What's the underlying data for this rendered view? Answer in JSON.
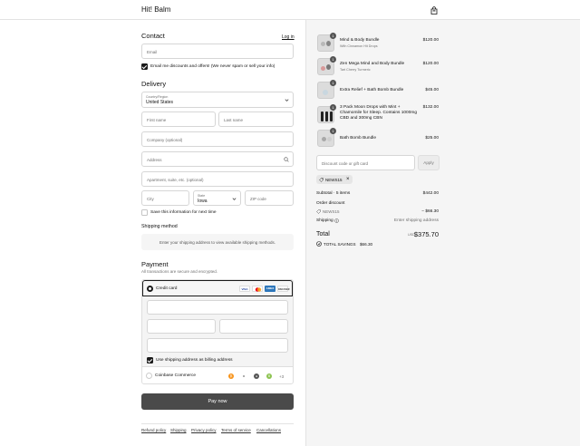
{
  "header": {
    "brand": "Hit! Balm"
  },
  "contact": {
    "title": "Contact",
    "login_label": "Log in",
    "email_placeholder": "Email",
    "marketing_label": "Email me discounts and offers! (We never spam or sell your info)"
  },
  "delivery": {
    "title": "Delivery",
    "country_label": "Country/Region",
    "country_value": "United States",
    "first_name_placeholder": "First name",
    "last_name_placeholder": "Last name",
    "company_placeholder": "Company (optional)",
    "address_placeholder": "Address",
    "apartment_placeholder": "Apartment, suite, etc. (optional)",
    "city_placeholder": "City",
    "state_label": "State",
    "state_value": "Iowa",
    "zip_placeholder": "ZIP code",
    "save_info_label": "Save this information for next time"
  },
  "shipping_method": {
    "title": "Shipping method",
    "notice": "Enter your shipping address to view available shipping methods."
  },
  "payment": {
    "title": "Payment",
    "subtitle": "All transactions are secure and encrypted.",
    "credit_card_label": "Credit card",
    "card_brands": [
      "VISA",
      "MC",
      "AMEX",
      "DISCOVER"
    ],
    "billing_label": "Use shipping address as billing address",
    "coinbase_label": "Coinbase Commerce",
    "coinbase_more": "+3",
    "pay_button": "Pay now"
  },
  "footer": {
    "links": [
      "Refund policy",
      "Shipping",
      "Privacy policy",
      "Terms of service",
      "Cancellations"
    ]
  },
  "order": {
    "items": [
      {
        "qty": "1",
        "name": "Mind & Body Bundle",
        "sub": "With Cinnamon Hit Drops",
        "price": "$120.00"
      },
      {
        "qty": "1",
        "name": "Zen Mega Mind and Body Bundle",
        "sub": "Tart Cherry Turmeric",
        "price": "$120.00"
      },
      {
        "qty": "1",
        "name": "Extra Relief + Bath Bomb Bundle",
        "sub": "",
        "price": "$45.00"
      },
      {
        "qty": "1",
        "name": "3 Pack Moon Drops with Mint + Chamomile for Sleep. Contains 1000mg CBD and 300mg CBN",
        "sub": "",
        "price": "$132.00"
      },
      {
        "qty": "1",
        "name": "Bath Bomb Bundle",
        "sub": "",
        "price": "$25.00"
      }
    ],
    "discount_placeholder": "Discount code or gift card",
    "apply_label": "Apply",
    "applied_code": "NEWS15",
    "subtotal_label": "Subtotal · 5 items",
    "subtotal_value": "$442.00",
    "order_discount_label": "Order discount",
    "discount_code": "NEWS15",
    "discount_value": "− $66.30",
    "shipping_label": "Shipping",
    "shipping_value": "Enter shipping address",
    "total_label": "Total",
    "currency": "USD",
    "total_value": "$375.70",
    "savings_label": "TOTAL SAVINGS",
    "savings_value": "$66.30"
  },
  "colors": {
    "primary_button": "#4a4a4a",
    "panel_bg": "#f5f5f5",
    "accent_amex": "#2e77bb"
  }
}
